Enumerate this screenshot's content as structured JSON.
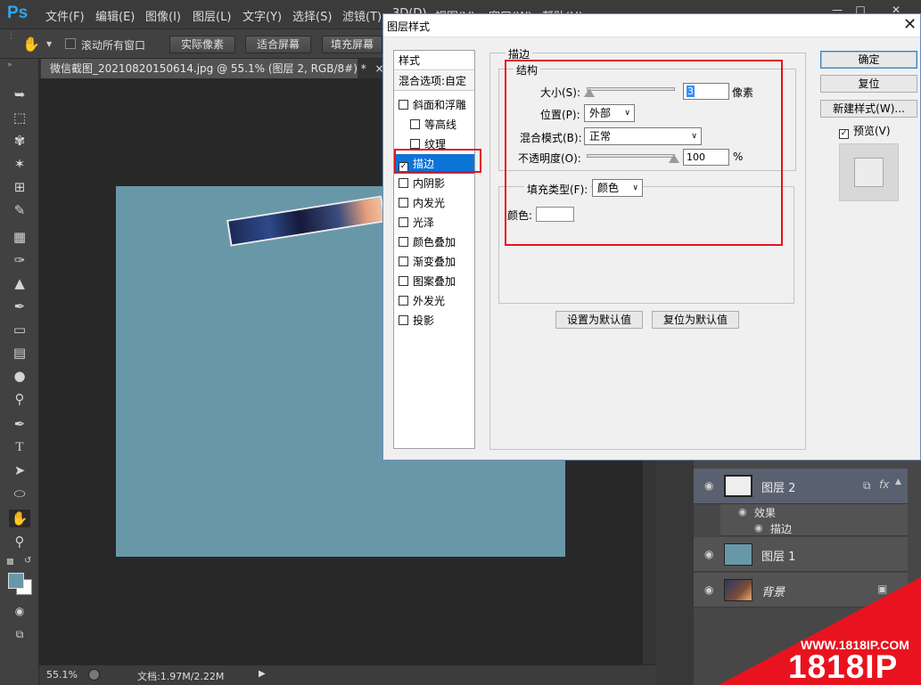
{
  "app": {
    "logo": "Ps",
    "menus": [
      "文件(F)",
      "编辑(E)",
      "图像(I)",
      "图层(L)",
      "文字(Y)",
      "选择(S)",
      "滤镜(T)",
      "3D(D)",
      "视图(V)",
      "窗口(W)",
      "帮助(H)"
    ]
  },
  "options": {
    "scroll_all_label": "滚动所有窗口",
    "actual_pixels": "实际像素",
    "fit_screen": "适合屏幕",
    "fill_screen": "填充屏幕"
  },
  "document": {
    "tab_title": "微信截图_20210820150614.jpg @ 55.1% (图层 2, RGB/8#) *",
    "tab_close": "×",
    "zoom": "55.1%",
    "doc_size": "文档:1.97M/2.22M"
  },
  "colors": {
    "canvas_bg": "#6898a8",
    "highlight_red": "#e6121c",
    "selected_blue": "#0c74d6",
    "watermark_red": "#e8131f"
  },
  "dialog": {
    "title": "图层样式",
    "close": "✕",
    "style_list": {
      "header": "样式",
      "blend_options": "混合选项:自定",
      "items": [
        {
          "label": "斜面和浮雕",
          "checked": false,
          "indent": false
        },
        {
          "label": "等高线",
          "checked": false,
          "indent": true
        },
        {
          "label": "纹理",
          "checked": false,
          "indent": true
        },
        {
          "label": "描边",
          "checked": true,
          "indent": false,
          "selected": true
        },
        {
          "label": "内阴影",
          "checked": false,
          "indent": false
        },
        {
          "label": "内发光",
          "checked": false,
          "indent": false
        },
        {
          "label": "光泽",
          "checked": false,
          "indent": false
        },
        {
          "label": "颜色叠加",
          "checked": false,
          "indent": false
        },
        {
          "label": "渐变叠加",
          "checked": false,
          "indent": false
        },
        {
          "label": "图案叠加",
          "checked": false,
          "indent": false
        },
        {
          "label": "外发光",
          "checked": false,
          "indent": false
        },
        {
          "label": "投影",
          "checked": false,
          "indent": false
        }
      ]
    },
    "stroke": {
      "section_title": "描边",
      "structure_title": "结构",
      "size_label": "大小(S):",
      "size_value": "3",
      "size_unit": "像素",
      "position_label": "位置(P):",
      "position_value": "外部",
      "blend_mode_label": "混合模式(B):",
      "blend_mode_value": "正常",
      "opacity_label": "不透明度(O):",
      "opacity_value": "100",
      "opacity_unit": "%",
      "fill_type_label": "填充类型(F):",
      "fill_type_value": "颜色",
      "color_label": "颜色:",
      "color_value": "#ffffff"
    },
    "buttons": {
      "set_default": "设置为默认值",
      "reset_default": "复位为默认值",
      "ok": "确定",
      "reset": "复位",
      "new_style": "新建样式(W)...",
      "preview_label": "预览(V)"
    }
  },
  "layers": {
    "layer2": "图层 2",
    "effects": "效果",
    "stroke": "描边",
    "layer1": "图层 1",
    "background": "背景",
    "fx": "fx"
  },
  "watermark": {
    "url": "WWW.1818IP.COM",
    "brand": "1818IP"
  }
}
